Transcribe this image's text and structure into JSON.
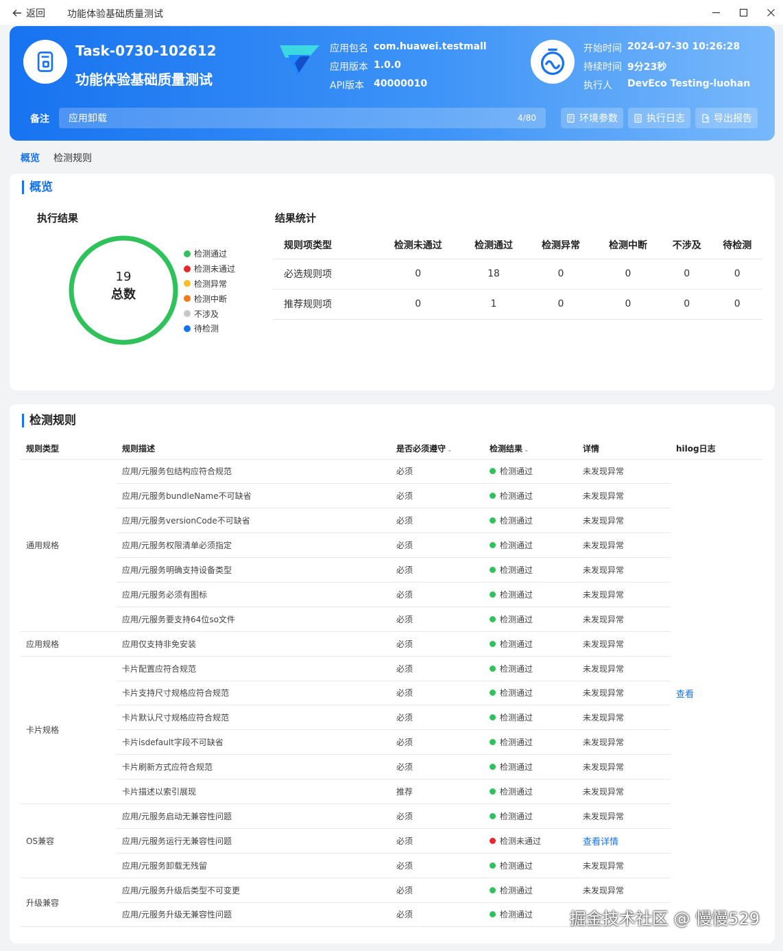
{
  "titlebar": {
    "back_label": "返回",
    "title": "功能体验基础质量测试"
  },
  "header": {
    "task_id": "Task-0730-102612",
    "task_name": "功能体验基础质量测试",
    "pkg_label": "应用包名",
    "pkg_value": "com.huawei.testmall",
    "ver_label": "应用版本",
    "ver_value": "1.0.0",
    "api_label": "API版本",
    "api_value": "40000010",
    "start_label": "开始时间",
    "start_value": "2024-07-30 10:26:28",
    "dur_label": "持续时间",
    "dur_value": "9分23秒",
    "exec_label": "执行人",
    "exec_value": "DevEco Testing-luohan",
    "note_label": "备注",
    "note_value": "应用卸载",
    "note_count": "4/80",
    "btn_env": "环境参数",
    "btn_log": "执行日志",
    "btn_export": "导出报告"
  },
  "tabs": [
    "概览",
    "检测规则"
  ],
  "overview": {
    "title": "概览",
    "exec_title": "执行结果",
    "total_num": "19",
    "total_label": "总数",
    "pass_fraction": 1.0,
    "legend": [
      {
        "label": "检测通过",
        "color": "#2fc25b"
      },
      {
        "label": "检测未通过",
        "color": "#e8262d"
      },
      {
        "label": "检测异常",
        "color": "#f5c024"
      },
      {
        "label": "检测中断",
        "color": "#f57a1f"
      },
      {
        "label": "不涉及",
        "color": "#c4c6c9"
      },
      {
        "label": "待检测",
        "color": "#1773f0"
      }
    ],
    "stats_title": "结果统计",
    "stats_headers": [
      "规则项类型",
      "检测未通过",
      "检测通过",
      "检测异常",
      "检测中断",
      "不涉及",
      "待检测"
    ],
    "stats_rows": [
      [
        "必选规则项",
        "0",
        "18",
        "0",
        "0",
        "0",
        "0"
      ],
      [
        "推荐规则项",
        "0",
        "1",
        "0",
        "0",
        "0",
        "0"
      ]
    ]
  },
  "rules": {
    "title": "检测规则",
    "headers": [
      "规则类型",
      "规则描述",
      "是否必须遵守",
      "检测结果",
      "详情",
      "hilog日志"
    ],
    "hilog_link": "查看",
    "groups": [
      {
        "type": "通用规格",
        "rows": [
          {
            "desc": "应用/元服务包结构应符合规范",
            "req": "必须",
            "result": "检测通过",
            "detail": "未发现异常"
          },
          {
            "desc": "应用/元服务bundleName不可缺省",
            "req": "必须",
            "result": "检测通过",
            "detail": "未发现异常"
          },
          {
            "desc": "应用/元服务versionCode不可缺省",
            "req": "必须",
            "result": "检测通过",
            "detail": "未发现异常"
          },
          {
            "desc": "应用/元服务权限清单必须指定",
            "req": "必须",
            "result": "检测通过",
            "detail": "未发现异常"
          },
          {
            "desc": "应用/元服务明确支持设备类型",
            "req": "必须",
            "result": "检测通过",
            "detail": "未发现异常"
          },
          {
            "desc": "应用/元服务必须有图标",
            "req": "必须",
            "result": "检测通过",
            "detail": "未发现异常"
          },
          {
            "desc": "应用/元服务要支持64位so文件",
            "req": "必须",
            "result": "检测通过",
            "detail": "未发现异常"
          }
        ]
      },
      {
        "type": "应用规格",
        "rows": [
          {
            "desc": "应用仅支持非免安装",
            "req": "必须",
            "result": "检测通过",
            "detail": "未发现异常"
          }
        ]
      },
      {
        "type": "卡片规格",
        "rows": [
          {
            "desc": "卡片配置应符合规范",
            "req": "必须",
            "result": "检测通过",
            "detail": "未发现异常"
          },
          {
            "desc": "卡片支持尺寸规格应符合规范",
            "req": "必须",
            "result": "检测通过",
            "detail": "未发现异常"
          },
          {
            "desc": "卡片默认尺寸规格应符合规范",
            "req": "必须",
            "result": "检测通过",
            "detail": "未发现异常"
          },
          {
            "desc": "卡片isdefault字段不可缺省",
            "req": "必须",
            "result": "检测通过",
            "detail": "未发现异常"
          },
          {
            "desc": "卡片刷新方式应符合规范",
            "req": "必须",
            "result": "检测通过",
            "detail": "未发现异常"
          },
          {
            "desc": "卡片描述以索引展现",
            "req": "推荐",
            "result": "检测通过",
            "detail": "未发现异常"
          }
        ]
      },
      {
        "type": "OS兼容",
        "rows": [
          {
            "desc": "应用/元服务启动无兼容性问题",
            "req": "必须",
            "result": "检测通过",
            "detail": "未发现异常"
          },
          {
            "desc": "应用/元服务运行无兼容性问题",
            "req": "必须",
            "result": "检测未通过",
            "detail": "查看详情",
            "fail": true
          },
          {
            "desc": "应用/元服务卸载无残留",
            "req": "必须",
            "result": "检测通过",
            "detail": "未发现异常"
          }
        ]
      },
      {
        "type": "升级兼容",
        "rows": [
          {
            "desc": "应用/元服务升级后类型不可变更",
            "req": "必须",
            "result": "检测通过",
            "detail": "未发现异常"
          },
          {
            "desc": "应用/元服务升级无兼容性问题",
            "req": "必须",
            "result": "检测通过",
            "detail": ""
          }
        ]
      }
    ]
  },
  "watermark": "掘金技术社区 @ 慢慢529",
  "colors": {
    "primary": "#1773f0",
    "pass": "#2fc25b",
    "fail": "#e8262d"
  }
}
